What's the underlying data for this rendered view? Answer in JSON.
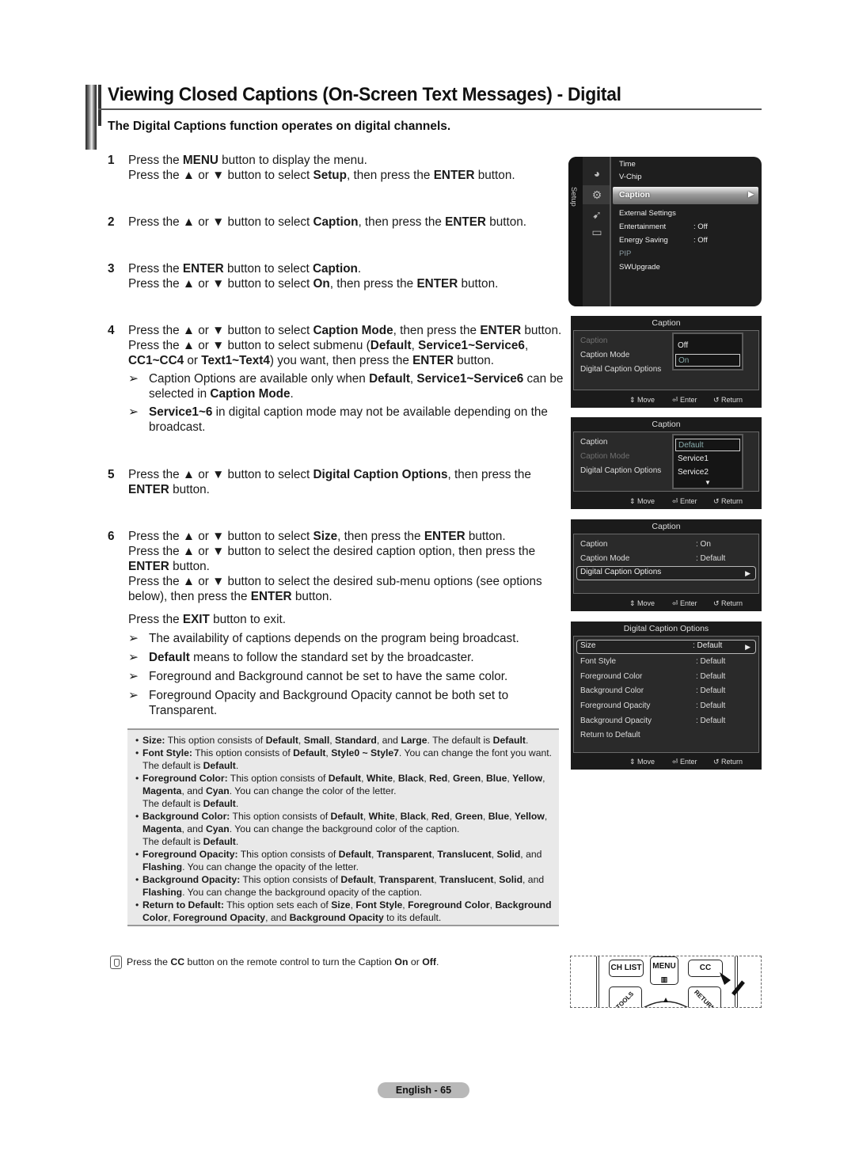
{
  "header": {
    "title": "Viewing Closed Captions (On-Screen Text Messages) - Digital",
    "subtitle": "The Digital Captions function operates on digital channels."
  },
  "steps": [
    {
      "num": "1",
      "lines": [
        [
          "Press the ",
          {
            "b": "MENU"
          },
          " button to display the menu."
        ],
        [
          "Press the ▲ or ▼ button to select ",
          {
            "b": "Setup"
          },
          ", then press the ",
          {
            "b": "ENTER"
          },
          " button."
        ]
      ]
    },
    {
      "num": "2",
      "lines": [
        [
          "Press the ▲ or ▼ button to select ",
          {
            "b": "Caption"
          },
          ", then press the ",
          {
            "b": "ENTER"
          },
          " button."
        ]
      ]
    },
    {
      "num": "3",
      "lines": [
        [
          "Press the ",
          {
            "b": "ENTER"
          },
          " button to select ",
          {
            "b": "Caption"
          },
          "."
        ],
        [
          "Press the ▲ or ▼ button to select ",
          {
            "b": "On"
          },
          ", then press the ",
          {
            "b": "ENTER"
          },
          " button."
        ]
      ]
    },
    {
      "num": "4",
      "lines": [
        [
          "Press the ▲ or ▼ button to select ",
          {
            "b": "Caption Mode"
          },
          ", then press the ",
          {
            "b": "ENTER"
          },
          " button."
        ],
        [
          "Press the ▲ or ▼ button to select submenu (",
          {
            "b": "Default"
          },
          ", ",
          {
            "b": "Service1~Service6"
          },
          ", ",
          {
            "b": "CC1~CC4"
          },
          " or ",
          {
            "b": "Text1~Text4"
          },
          ") you want, then press the ",
          {
            "b": "ENTER"
          },
          " button."
        ]
      ],
      "notes": [
        [
          "Caption Options are available only when ",
          {
            "b": "Default"
          },
          ", ",
          {
            "b": "Service1~Service6"
          },
          " can be selected in ",
          {
            "b": "Caption Mode"
          },
          "."
        ],
        [
          {
            "b": "Service1~6"
          },
          " in digital caption mode may not be available depending on the broadcast."
        ]
      ]
    },
    {
      "num": "5",
      "lines": [
        [
          "Press the ▲ or ▼ button to select ",
          {
            "b": "Digital Caption Options"
          },
          ", then press the ",
          {
            "b": "ENTER"
          },
          " button."
        ]
      ]
    },
    {
      "num": "6",
      "lines": [
        [
          "Press the ▲ or ▼ button to select ",
          {
            "b": "Size"
          },
          ", then press the ",
          {
            "b": "ENTER"
          },
          " button."
        ],
        [
          "Press the ▲ or ▼ button to select the desired caption option, then press the ",
          {
            "b": "ENTER"
          },
          " button."
        ],
        [
          "Press the ▲ or ▼ button to select the desired sub-menu options (see options below), then press the ",
          {
            "b": "ENTER"
          },
          " button."
        ]
      ]
    }
  ],
  "exit_block": {
    "line": [
      "Press the ",
      {
        "b": "EXIT"
      },
      " button to exit."
    ],
    "notes": [
      [
        "The availability of captions depends on the program being broadcast."
      ],
      [
        {
          "b": "Default"
        },
        " means to follow the standard set by the broadcaster."
      ],
      [
        "Foreground and Background cannot be set to have the same color."
      ],
      [
        "Foreground Opacity and Background Opacity cannot be both set to Transparent."
      ]
    ]
  },
  "note_arrow": "➢",
  "bullet": "•",
  "infobox": [
    [
      {
        "b": "Size:"
      },
      " This option consists of ",
      {
        "b": "Default"
      },
      ", ",
      {
        "b": "Small"
      },
      ", ",
      {
        "b": "Standard"
      },
      ", and ",
      {
        "b": "Large"
      },
      ". The default is ",
      {
        "b": "Default"
      },
      "."
    ],
    [
      {
        "b": "Font Style:"
      },
      " This option consists of ",
      {
        "b": "Default"
      },
      ", ",
      {
        "b": "Style0 ~ Style7"
      },
      ". You can change the font you want. The default is ",
      {
        "b": "Default"
      },
      "."
    ],
    [
      {
        "b": "Foreground Color:"
      },
      " This option consists of ",
      {
        "b": "Default"
      },
      ", ",
      {
        "b": "White"
      },
      ", ",
      {
        "b": "Black"
      },
      ", ",
      {
        "b": "Red"
      },
      ", ",
      {
        "b": "Green"
      },
      ", ",
      {
        "b": "Blue"
      },
      ", ",
      {
        "b": "Yellow"
      },
      ", ",
      {
        "b": "Magenta"
      },
      ", and ",
      {
        "b": "Cyan"
      },
      ". You can change the color of the letter.",
      {
        "br": true
      },
      "The default is ",
      {
        "b": "Default"
      },
      "."
    ],
    [
      {
        "b": "Background Color:"
      },
      " This option consists of ",
      {
        "b": "Default"
      },
      ", ",
      {
        "b": "White"
      },
      ", ",
      {
        "b": "Black"
      },
      ", ",
      {
        "b": "Red"
      },
      ", ",
      {
        "b": "Green"
      },
      ", ",
      {
        "b": "Blue"
      },
      ", ",
      {
        "b": "Yellow"
      },
      ", ",
      {
        "b": "Magenta"
      },
      ", and ",
      {
        "b": "Cyan"
      },
      ". You can change the background color of the caption.",
      {
        "br": true
      },
      "The default is ",
      {
        "b": "Default"
      },
      "."
    ],
    [
      {
        "b": "Foreground Opacity:"
      },
      " This option consists of ",
      {
        "b": "Default"
      },
      ", ",
      {
        "b": "Transparent"
      },
      ", ",
      {
        "b": "Translucent"
      },
      ", ",
      {
        "b": "Solid"
      },
      ", and ",
      {
        "b": "Flashing"
      },
      ". You can change the opacity of the letter."
    ],
    [
      {
        "b": "Background Opacity:"
      },
      " This option consists of ",
      {
        "b": "Default"
      },
      ", ",
      {
        "b": "Transparent"
      },
      ", ",
      {
        "b": "Translucent"
      },
      ", ",
      {
        "b": "Solid"
      },
      ", and ",
      {
        "b": "Flashing"
      },
      ". You can change the background opacity of the caption."
    ],
    [
      {
        "b": "Return to Default:"
      },
      " This option sets each of ",
      {
        "b": "Size"
      },
      ", ",
      {
        "b": "Font Style"
      },
      ", ",
      {
        "b": "Foreground Color"
      },
      ", ",
      {
        "b": "Background Color"
      },
      ", ",
      {
        "b": "Foreground Opacity"
      },
      ", and ",
      {
        "b": "Background Opacity"
      },
      " to its default."
    ]
  ],
  "tip": [
    "Press the ",
    {
      "b": "CC"
    },
    " button on the remote control to turn the Caption ",
    {
      "b": "On"
    },
    " or ",
    {
      "b": "Off"
    },
    "."
  ],
  "setup_menu": {
    "side_label": "Setup",
    "items": [
      {
        "label": "Time",
        "value": ""
      },
      {
        "label": "V-Chip",
        "value": ""
      },
      {
        "label": "Caption",
        "value": "",
        "selected": true
      },
      {
        "label": "External Settings",
        "value": ""
      },
      {
        "label": "Entertainment",
        "value": ": Off"
      },
      {
        "label": "Energy Saving",
        "value": ": Off"
      },
      {
        "label": "PIP",
        "value": "",
        "dim": true
      },
      {
        "label": "SWUpgrade",
        "value": ""
      }
    ],
    "arrow": "▶"
  },
  "osd_footer": {
    "move": "⇕ Move",
    "enter": "⏎ Enter",
    "return": "↺ Return"
  },
  "osd1": {
    "title": "Caption",
    "rows": [
      {
        "label": "Caption",
        "dim": true
      },
      {
        "label": "Caption Mode",
        "dim": false
      },
      {
        "label": "Digital Caption Options",
        "dim": false
      }
    ],
    "popup": [
      "Off",
      "On"
    ],
    "popup_selected": 1
  },
  "osd2": {
    "title": "Caption",
    "rows": [
      {
        "label": "Caption",
        "dim": false
      },
      {
        "label": "Caption Mode",
        "dim": true
      },
      {
        "label": "Digital Caption Options",
        "dim": false
      }
    ],
    "popup": [
      "Default",
      "Service1",
      "Service2"
    ],
    "popup_selected": 0,
    "more": "▼"
  },
  "osd3": {
    "title": "Caption",
    "rows": [
      {
        "label": "Caption",
        "value": ": On"
      },
      {
        "label": "Caption Mode",
        "value": ": Default"
      },
      {
        "label": "Digital Caption Options",
        "value": "",
        "selected": true
      }
    ]
  },
  "osd4": {
    "title": "Digital Caption Options",
    "rows": [
      {
        "label": "Size",
        "value": ": Default",
        "selected": true
      },
      {
        "label": "Font Style",
        "value": ": Default"
      },
      {
        "label": "Foreground Color",
        "value": ": Default"
      },
      {
        "label": "Background Color",
        "value": ": Default"
      },
      {
        "label": "Foreground Opacity",
        "value": ": Default"
      },
      {
        "label": "Background Opacity",
        "value": ": Default"
      },
      {
        "label": "Return to Default",
        "value": ""
      }
    ]
  },
  "remote": {
    "buttons": [
      "CH LIST",
      "MENU",
      "CC"
    ],
    "tools_label": "TOOLS",
    "return_label": "RETURN"
  },
  "page_number": "English - 65"
}
